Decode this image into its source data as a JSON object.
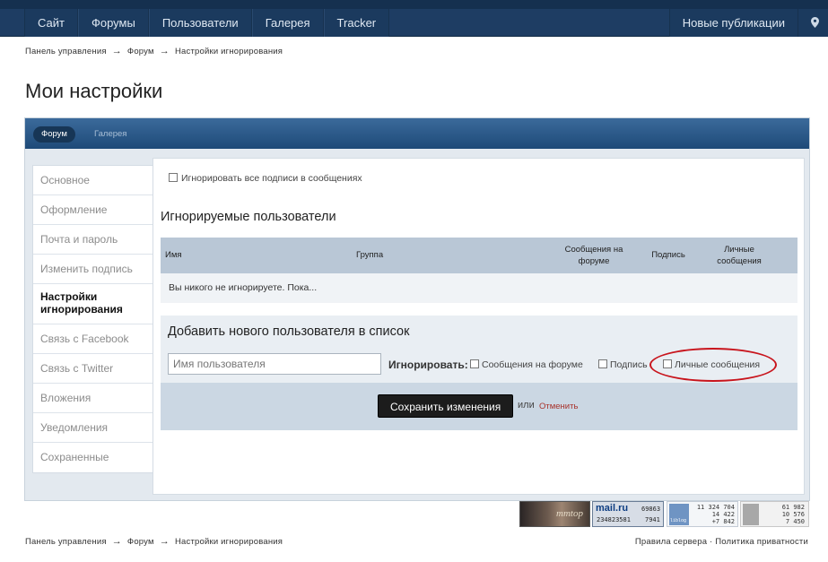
{
  "nav": {
    "tabs": [
      {
        "label": "Сайт"
      },
      {
        "label": "Форумы"
      },
      {
        "label": "Пользователи"
      },
      {
        "label": "Галерея"
      },
      {
        "label": "Tracker"
      }
    ],
    "new_posts": "Новые публикации",
    "location_icon": "map-pin-icon"
  },
  "breadcrumb": {
    "items": [
      "Панель управления",
      "Форум",
      "Настройки игнорирования"
    ],
    "separator": "→"
  },
  "page_title": "Мои настройки",
  "subtabs": {
    "active": "Форум",
    "other": "Галерея"
  },
  "sidebar": {
    "items": [
      {
        "label": "Основное"
      },
      {
        "label": "Оформление"
      },
      {
        "label": "Почта и пароль"
      },
      {
        "label": "Изменить подпись"
      },
      {
        "label": "Настройки игнорирования",
        "active": true
      },
      {
        "label": "Связь с Facebook"
      },
      {
        "label": "Связь с Twitter"
      },
      {
        "label": "Вложения"
      },
      {
        "label": "Уведомления"
      },
      {
        "label": "Сохраненные"
      }
    ]
  },
  "ignore_all_signatures": {
    "label": "Игнорировать все подписи в сообщениях",
    "checked": false
  },
  "ignored_users": {
    "heading": "Игнорируемые пользователи",
    "columns": {
      "name": "Имя",
      "group": "Группа",
      "forum_posts": "Сообщения на форуме",
      "signature": "Подпись",
      "private_messages": "Личные сообщения"
    },
    "empty_text": "Вы никого не игнорируете. Пока..."
  },
  "add_user": {
    "heading": "Добавить нового пользователя в список",
    "username_placeholder": "Имя пользователя",
    "ignore_label": "Игнорировать:",
    "options": [
      {
        "label": "Сообщения на форуме",
        "checked": false
      },
      {
        "label": "Подпись",
        "checked": false
      },
      {
        "label": "Личные сообщения",
        "checked": false
      }
    ],
    "save_label": "Сохранить изменения",
    "or_text": "или",
    "cancel_label": "Отменить"
  },
  "annotation": {
    "color": "#c8141c",
    "target": "Личные сообщения"
  },
  "counters": {
    "mail_ru": {
      "brand": "mail.ru",
      "a": "69863",
      "b": "234823581",
      "c": "7941"
    },
    "liveinternet": {
      "a": "11 324 704",
      "b": "14 422",
      "c": "+7 842",
      "brand": "liblog"
    },
    "stats": {
      "a": "61 982",
      "b": "10 576",
      "c": "7 450"
    },
    "banner_text": "mmtop"
  },
  "footer": {
    "rules": "Правила сервера",
    "dot": "·",
    "privacy": "Политика приватности"
  }
}
